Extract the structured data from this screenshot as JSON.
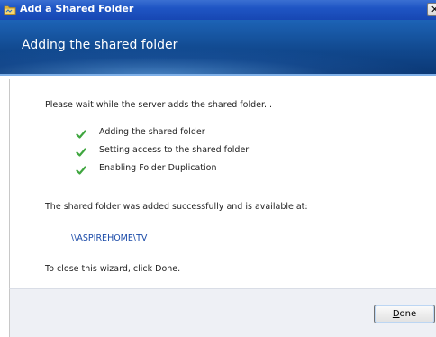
{
  "window": {
    "title": "Add a Shared Folder",
    "close_glyph": "✕"
  },
  "banner": {
    "heading": "Adding the shared folder"
  },
  "content": {
    "wait_message": "Please wait while the server adds the shared folder...",
    "steps": [
      {
        "label": "Adding the shared folder",
        "status": "complete",
        "icon": "check-icon"
      },
      {
        "label": "Setting access to the shared folder",
        "status": "complete",
        "icon": "check-icon"
      },
      {
        "label": "Enabling Folder Duplication",
        "status": "complete",
        "icon": "check-icon"
      }
    ],
    "success_message": "The shared folder was added successfully and is available at:",
    "share_path": "\\\\ASPIREHOME\\TV",
    "close_instruction": "To close this wizard, click Done."
  },
  "footer": {
    "done_button": {
      "accel": "D",
      "rest": "one"
    }
  },
  "colors": {
    "titlebar": "#1f55c4",
    "banner": "#11498f",
    "check": "#3fa63f",
    "link": "#1a4aa8",
    "footer": "#eef0f5"
  }
}
